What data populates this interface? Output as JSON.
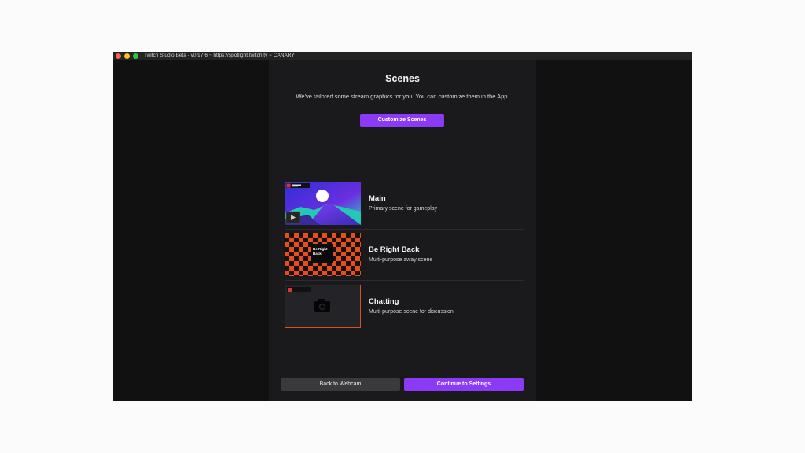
{
  "window": {
    "title": "Twitch Studio Beta - v0.97.6 ~ https://spotlight.twitch.tv ~ CANARY"
  },
  "colors": {
    "accent": "#8b3bf6",
    "panel": "#1a1a1d",
    "background": "#111111"
  },
  "scenes_page": {
    "heading": "Scenes",
    "subtitle": "We've tailored some stream graphics for you. You can customize them in the App.",
    "customize_label": "Customize Scenes",
    "scenes": [
      {
        "title": "Main",
        "description": "Primary scene for gameplay",
        "thumb": "gameplay-landscape"
      },
      {
        "title": "Be Right Back",
        "description": "Multi-purpose away scene",
        "thumb": "checkerboard-brb",
        "card_text": "Be Right Back"
      },
      {
        "title": "Chatting",
        "description": "Multi-purpose scene for discussion",
        "thumb": "camera-icon"
      }
    ]
  },
  "footer": {
    "back_label": "Back to Webcam",
    "continue_label": "Continue to Settings"
  }
}
